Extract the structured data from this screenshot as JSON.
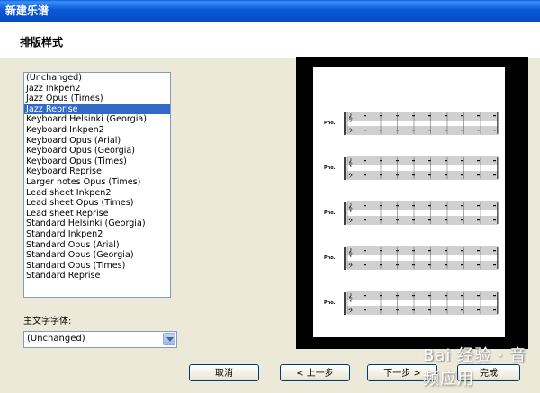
{
  "window": {
    "title": "新建乐谱"
  },
  "header": {
    "title": "排版样式"
  },
  "styles": {
    "items": [
      "(Unchanged)",
      "Jazz Inkpen2",
      "Jazz Opus (Times)",
      "Jazz Reprise",
      "Keyboard Helsinki (Georgia)",
      "Keyboard Inkpen2",
      "Keyboard Opus (Arial)",
      "Keyboard Opus (Georgia)",
      "Keyboard Opus (Times)",
      "Keyboard Reprise",
      "Larger notes Opus (Times)",
      "Lead sheet Inkpen2",
      "Lead sheet Opus (Times)",
      "Lead sheet Reprise",
      "Standard Helsinki (Georgia)",
      "Standard Inkpen2",
      "Standard Opus (Arial)",
      "Standard Opus (Georgia)",
      "Standard Opus (Times)",
      "Standard Reprise"
    ],
    "selected_index": 3
  },
  "font": {
    "label": "主文字字体:",
    "value": "(Unchanged)"
  },
  "preview": {
    "staff_label": "Pno.",
    "systems": 5
  },
  "buttons": {
    "cancel": "取消",
    "back": "< 上一步",
    "next": "下一步 >",
    "finish": "完成"
  },
  "watermark": {
    "text": "Bai 经验 · 音频应用"
  }
}
